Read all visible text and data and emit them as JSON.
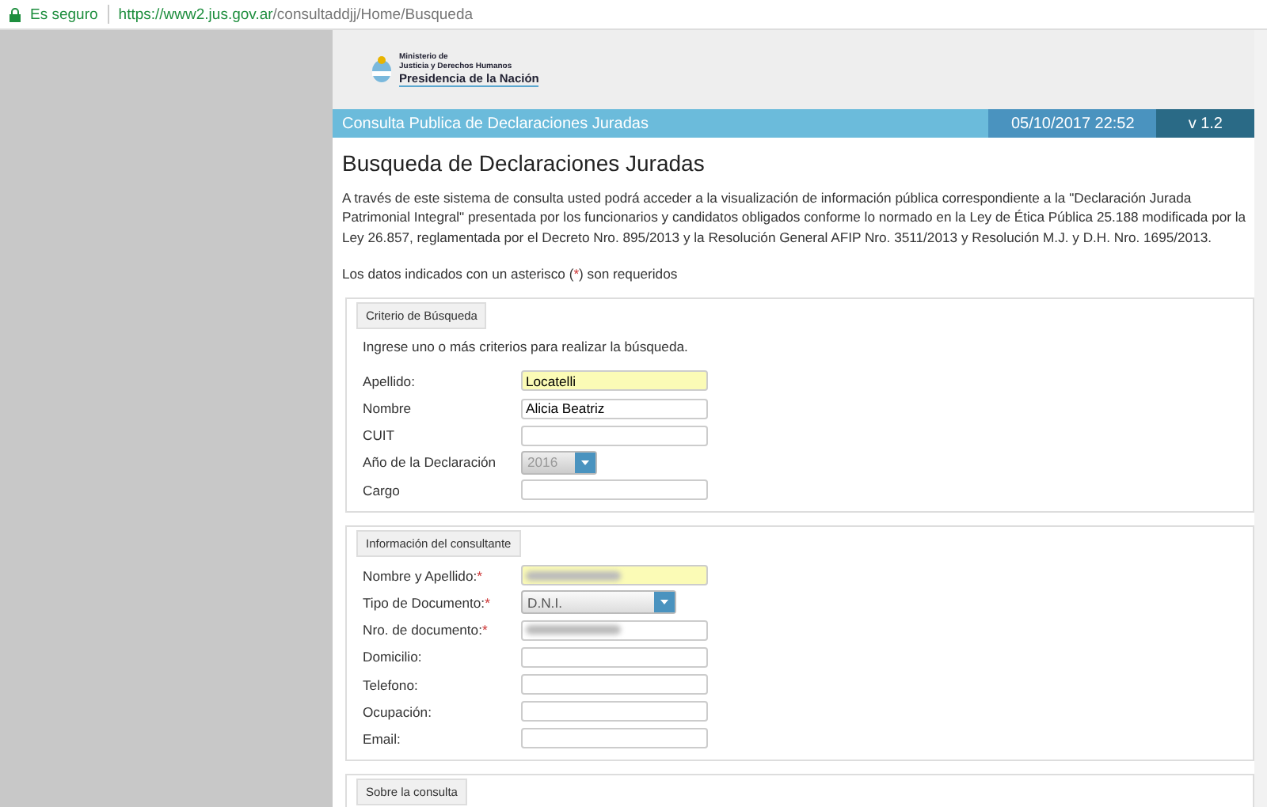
{
  "address_bar": {
    "security": "Es seguro",
    "url_host": "https://www2.jus.gov.ar",
    "url_path": "/consultaddjj/Home/Busqueda"
  },
  "logo": {
    "line_1": "Ministerio de",
    "line_2": "Justicia y Derechos Humanos",
    "line_3": "Presidencia de la Nación"
  },
  "header_bar": {
    "title": "Consulta Publica de Declaraciones Juradas",
    "datetime": "05/10/2017 22:52",
    "version": "v 1.2"
  },
  "page_title": "Busqueda de Declaraciones Juradas",
  "intro": "A través de este sistema de consulta usted podrá acceder a la visualización de información pública correspondiente a la \"Declaración Jurada Patrimonial Integral\" presentada por los funcionarios y candidatos obligados conforme lo normado en la Ley de Ética Pública 25.188 modificada por la Ley 26.857, reglamentada por el Decreto Nro. 895/2013 y la Resolución General AFIP Nro. 3511/2013 y Resolución M.J. y D.H. Nro. 1695/2013.",
  "required_note": {
    "before": "Los datos indicados con un asterisco (",
    "mark": "*",
    "after": ") son requeridos"
  },
  "fieldsets": [
    {
      "legend": "Criterio de Búsqueda",
      "hint": "Ingrese uno o más criterios para realizar la búsqueda.",
      "fields": [
        {
          "label": "Apellido:",
          "kind": "text",
          "value": "Locatelli",
          "required": false,
          "highlighted": true,
          "blurred": false
        },
        {
          "label": "Nombre",
          "kind": "text",
          "value": "Alicia Beatriz",
          "required": false,
          "highlighted": false,
          "blurred": false
        },
        {
          "label": "CUIT",
          "kind": "text",
          "required": false,
          "highlighted": false,
          "blurred": false
        },
        {
          "label": "Año de la Declaración",
          "kind": "select",
          "value": "2016",
          "disabled": true,
          "required": false,
          "highlighted": false,
          "blurred": false
        },
        {
          "label": "Cargo",
          "kind": "text",
          "required": false,
          "highlighted": false,
          "blurred": false
        }
      ]
    },
    {
      "legend": "Información del consultante",
      "fields": [
        {
          "label": "Nombre y Apellido:",
          "kind": "text",
          "required": true,
          "highlighted": true,
          "blurred": true
        },
        {
          "label": "Tipo de Documento:",
          "kind": "select",
          "value": "D.N.I.",
          "disabled": false,
          "required": true,
          "highlighted": false,
          "blurred": false
        },
        {
          "label": "Nro. de documento:",
          "kind": "text",
          "required": true,
          "highlighted": false,
          "blurred": true
        },
        {
          "label": "Domicilio:",
          "kind": "text",
          "required": false,
          "highlighted": false,
          "blurred": false
        },
        {
          "label": "Telefono:",
          "kind": "text",
          "required": false,
          "highlighted": false,
          "blurred": false
        },
        {
          "label": "Ocupación:",
          "kind": "text",
          "required": false,
          "highlighted": false,
          "blurred": false
        },
        {
          "label": "Email:",
          "kind": "text",
          "required": false,
          "highlighted": false,
          "blurred": false
        }
      ]
    },
    {
      "legend": "Sobre la consulta"
    }
  ]
}
